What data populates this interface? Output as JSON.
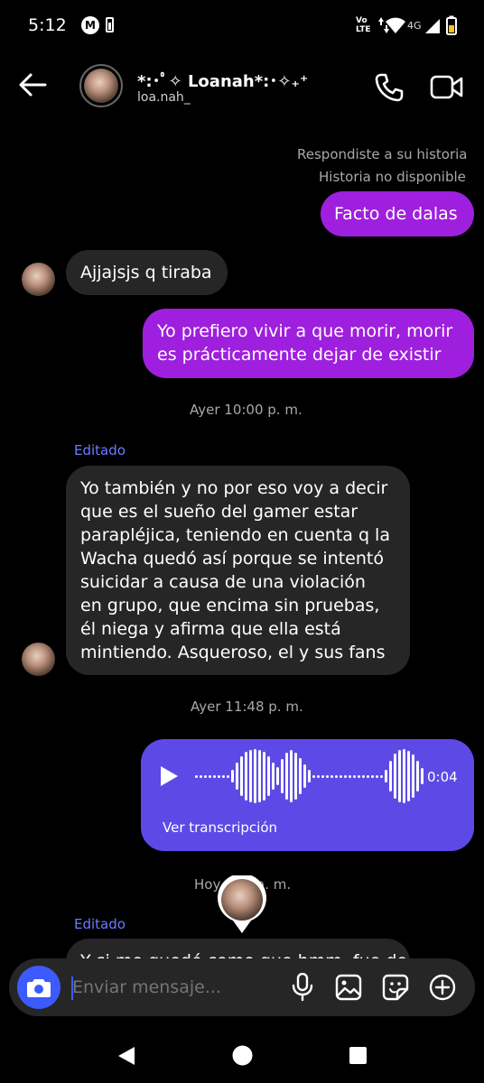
{
  "status": {
    "time": "5:12",
    "network": "4G",
    "volte": "Vo LTE"
  },
  "header": {
    "name": "*:･ﾟ✧ Loanah*:･ﾟ✧*:･ﾟ",
    "name_display": "*:･ﾟ✧ Loanah*:･✧₊⁺",
    "username": "loa.nah_"
  },
  "messages": {
    "story_reply_label": "Respondiste a su historia",
    "story_unavailable": "Historia no disponible",
    "m1": "Facto de dalas",
    "m2": "Ajjajsjs q tiraba",
    "m3_line1": "Yo prefiero vivir a que morir, morir",
    "m3_line2": "es prácticamente dejar de existir",
    "ts1": "Ayer 10:00 p. m.",
    "edited1": "Editado",
    "m4_lines": [
      "Yo también y no por eso voy a decir",
      "que es el sueño del gamer estar",
      "parapléjica, teniendo en cuenta q la",
      "Wacha quedó así porque se intentó",
      "suicidar a causa de una violación",
      "en grupo, que encima sin pruebas,",
      "él niega y afirma que ella está",
      "mintiendo. Asqueroso, el y sus fans"
    ],
    "ts2": "Ayer 11:48 p. m.",
    "voice_duration": "0:04",
    "voice_transcript": "Ver transcripción",
    "ts3": "Hoy 1:__ a. m.",
    "ts3_left": "Hoy",
    "ts3_right": "a. m.",
    "edited2": "Editado",
    "m5_partial": "Y si me quedé como que hmm, fue de"
  },
  "composer": {
    "placeholder": "Enviar mensaje..."
  },
  "colors": {
    "outgoing": "#9f1fde",
    "incoming": "#262626",
    "voice": "#5d4ae6",
    "edited": "#6b7cff",
    "camera_button": "#3d5afe"
  }
}
